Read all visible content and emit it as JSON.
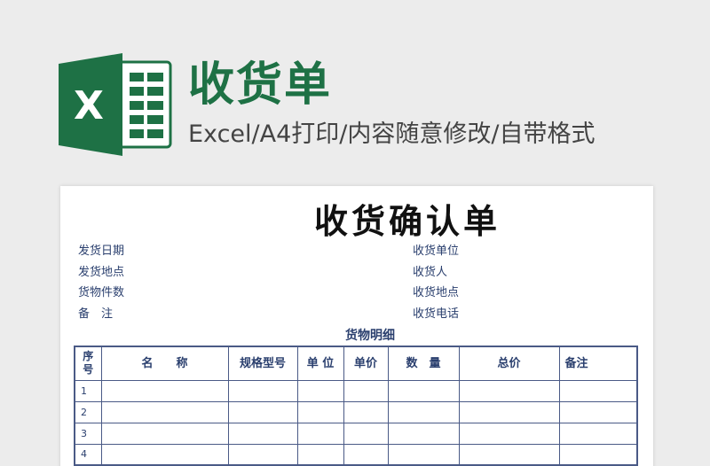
{
  "banner": {
    "title": "收货单",
    "subtitle": "Excel/A4打印/内容随意修改/自带格式",
    "logo_letter": "X",
    "colors": {
      "brand_green": "#1e7145",
      "brand_green_light": "#21a366"
    }
  },
  "document": {
    "title": "收货确认单",
    "left_fields": [
      "发货日期",
      "发货地点",
      "货物件数",
      "备　注"
    ],
    "right_fields": [
      "收货单位",
      "收货人",
      "收货地点",
      "收货电话"
    ],
    "section_label": "货物明细",
    "table": {
      "headers": [
        "序号",
        "名　　称",
        "规格型号",
        "单 位",
        "单价",
        "数　量",
        "总价",
        "备注"
      ],
      "rows": [
        "1",
        "2",
        "3",
        "4"
      ]
    }
  }
}
